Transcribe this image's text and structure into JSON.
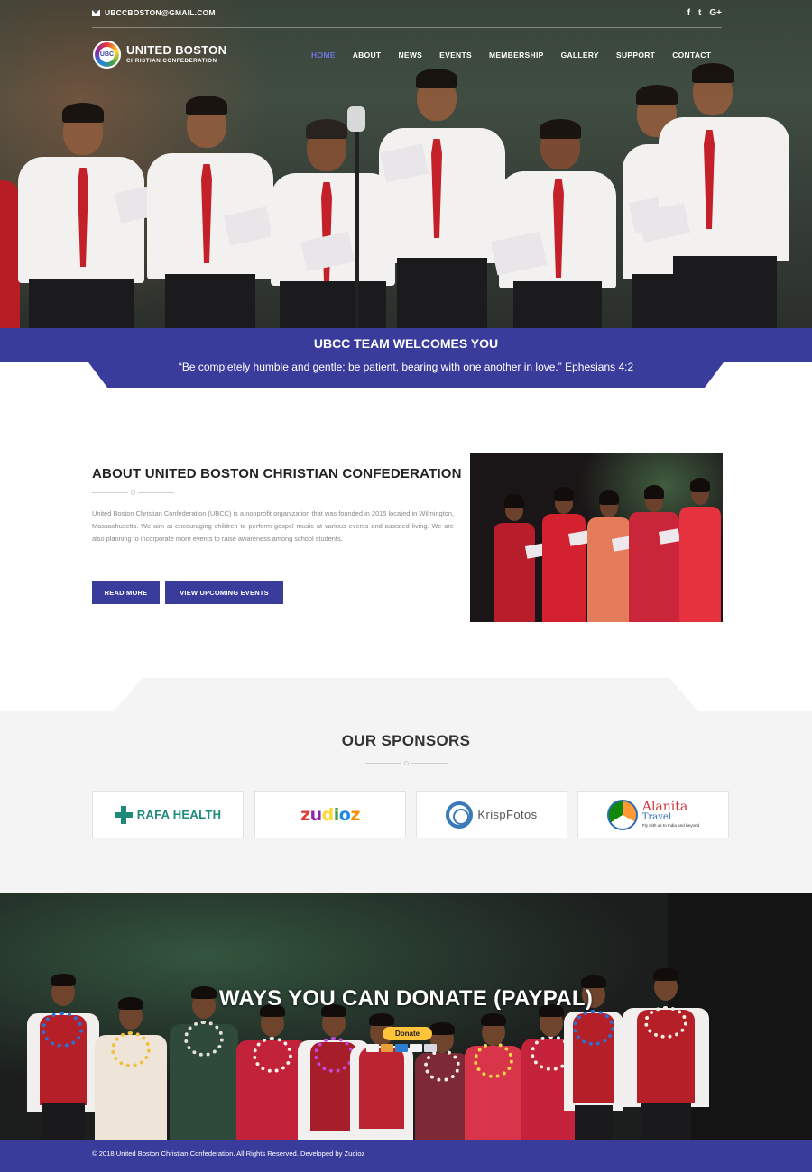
{
  "topbar": {
    "email": "UBCCBOSTON@GMAIL.COM",
    "social": [
      "f",
      "t",
      "G+"
    ],
    "social_icons": [
      "facebook-icon",
      "twitter-icon",
      "google-plus-icon"
    ]
  },
  "brand": {
    "name_line1": "UNITED BOSTON",
    "name_line2": "CHRISTIAN CONFEDERATION",
    "logo_text": "UBC"
  },
  "nav": {
    "items": [
      "HOME",
      "ABOUT",
      "NEWS",
      "EVENTS",
      "MEMBERSHIP",
      "GALLERY",
      "SUPPORT",
      "CONTACT"
    ],
    "active": "HOME"
  },
  "welcome": {
    "title": "UBCC TEAM WELCOMES YOU",
    "verse": "“Be completely humble and gentle; be patient, bearing with one another in love.” Ephesians 4:2"
  },
  "about": {
    "heading": "ABOUT UNITED BOSTON CHRISTIAN CONFEDERATION",
    "body": "United Boston Christian Confederation (UBCC) is a nonprofit organization that was founded in 2015 located in Wilmington, Massachusetts. We aim at encouraging children to perform gospel music at various events and assisted living. We are also planning to incorporate more events to raise awareness among school students.",
    "read_more": "READ MORE",
    "view_events": "VIEW UPCOMING EVENTS"
  },
  "sponsors": {
    "heading": "OUR SPONSORS",
    "items": [
      {
        "name": "RAFA HEALTH"
      },
      {
        "name": "zudioz"
      },
      {
        "name": "KrispFotos"
      },
      {
        "name": "Alanita",
        "line2": "Travel",
        "tagline": "Fly with us to India and beyond"
      }
    ]
  },
  "donate": {
    "heading": "WAYS YOU CAN DONATE (PAYPAL)",
    "button": "Donate"
  },
  "footer": {
    "text": "© 2018 United Boston Christian Confederation. All Rights Reserved. Developed by Zudioz"
  },
  "colors": {
    "primary": "#3a3c9c",
    "nav_active": "#6e74e0",
    "paypal": "#ffc439",
    "sponsor_bg": "#f4f4f4"
  }
}
